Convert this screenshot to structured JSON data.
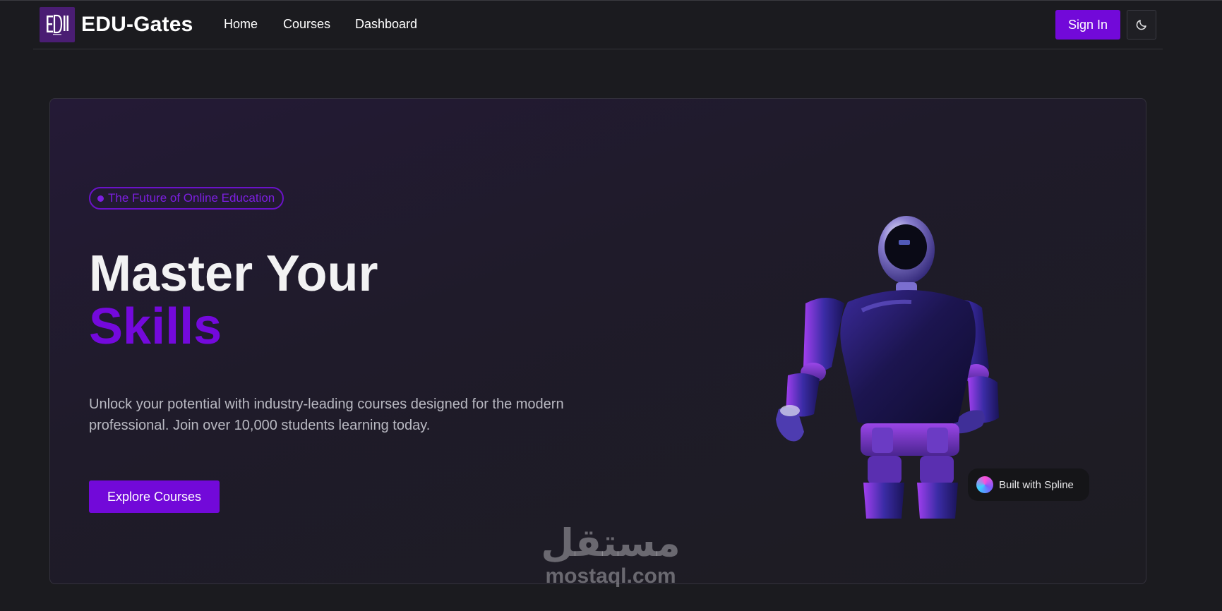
{
  "nav": {
    "logo_icon": "edu-logo-icon",
    "brand": "EDU-Gates",
    "links": [
      "Home",
      "Courses",
      "Dashboard"
    ],
    "signin_label": "Sign In",
    "theme_icon": "moon-icon"
  },
  "hero": {
    "badge": "The Future of Online Education",
    "title_line1": "Master Your",
    "title_line2": "Skills",
    "description": "Unlock your potential with industry-leading courses designed for the modern professional. Join over 10,000 students learning today.",
    "cta_label": "Explore Courses",
    "spline_label": "Built with Spline"
  },
  "watermark": {
    "arabic": "مستقل",
    "latin": "mostaql.com"
  },
  "colors": {
    "accent": "#7209d9",
    "background": "#1b1b1f"
  }
}
